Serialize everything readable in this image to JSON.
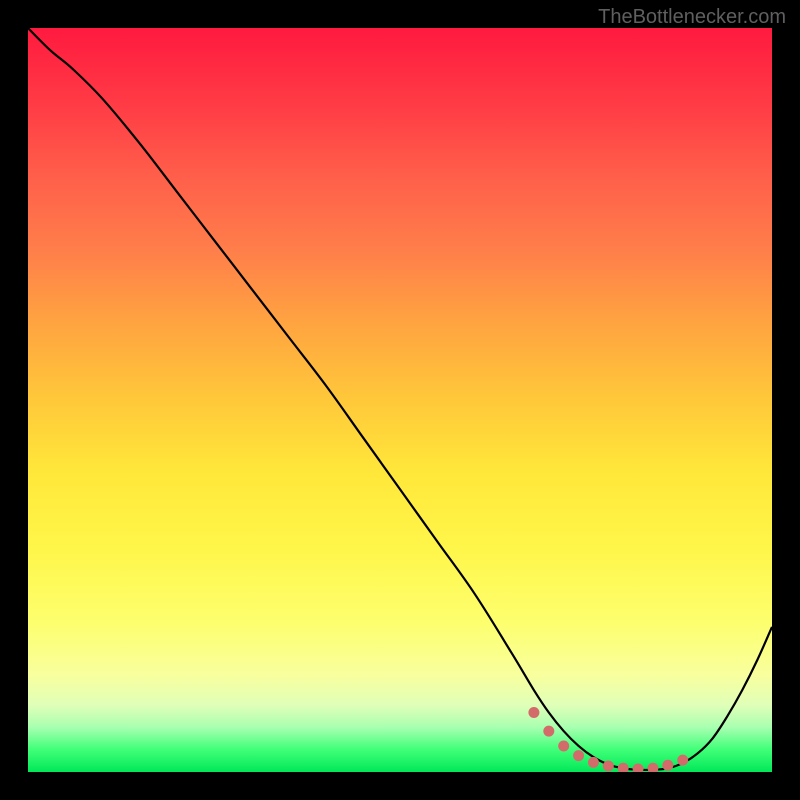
{
  "attribution": "TheBottlenecker.com",
  "chart_data": {
    "type": "line",
    "title": "",
    "xlabel": "",
    "ylabel": "",
    "xlim": [
      0,
      100
    ],
    "ylim": [
      0,
      100
    ],
    "x": [
      0,
      3,
      6,
      10,
      15,
      20,
      25,
      30,
      35,
      40,
      45,
      50,
      55,
      60,
      65,
      68,
      70,
      72,
      74,
      76,
      78,
      80,
      82,
      84,
      86,
      88,
      90,
      92,
      94,
      96,
      98,
      100
    ],
    "values": [
      100,
      97,
      94.5,
      90.5,
      84.5,
      78,
      71.5,
      65,
      58.5,
      52,
      45,
      38,
      31,
      24,
      16,
      11,
      8,
      5.5,
      3.5,
      2,
      1,
      0.5,
      0.3,
      0.3,
      0.5,
      1.2,
      2.5,
      4.5,
      7.5,
      11,
      15,
      19.5
    ],
    "markers": {
      "x": [
        68,
        70,
        72,
        74,
        76,
        78,
        80,
        82,
        84,
        86,
        88
      ],
      "y": [
        8,
        5.5,
        3.5,
        2.2,
        1.3,
        0.8,
        0.5,
        0.4,
        0.5,
        0.9,
        1.6
      ]
    },
    "colors": {
      "curve": "#000000",
      "markers": "#d46b6b"
    }
  }
}
